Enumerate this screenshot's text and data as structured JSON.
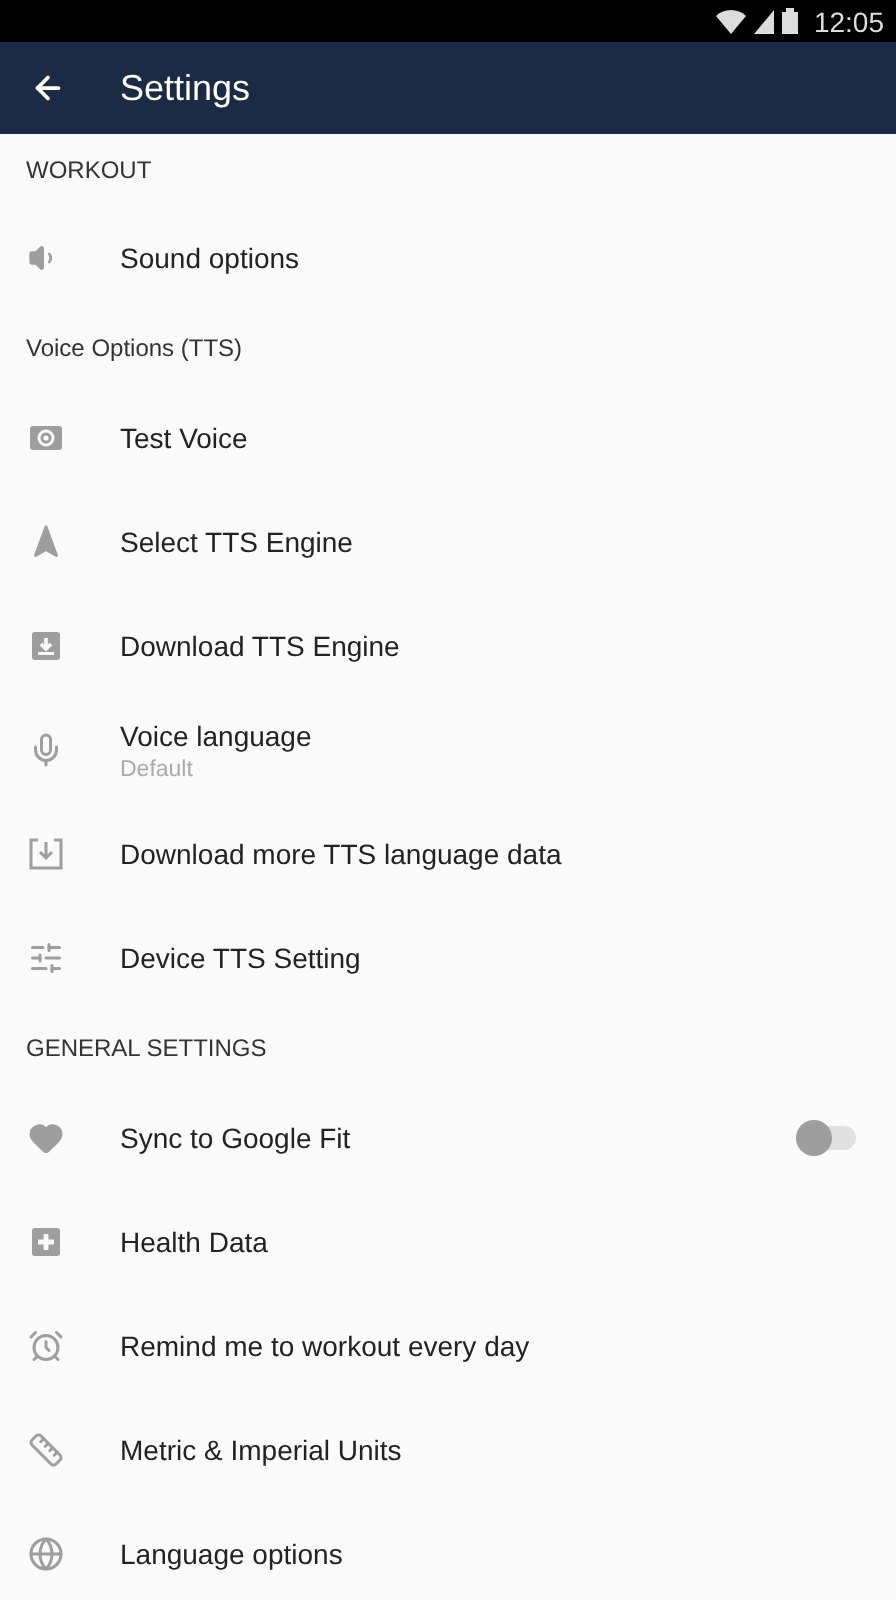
{
  "status_bar": {
    "time": "12:05"
  },
  "app_bar": {
    "title": "Settings"
  },
  "sections": [
    {
      "title": "WORKOUT",
      "items": [
        {
          "title": "Sound options"
        }
      ]
    },
    {
      "title": "Voice Options (TTS)",
      "items": [
        {
          "title": "Test Voice"
        },
        {
          "title": "Select TTS Engine"
        },
        {
          "title": "Download TTS Engine"
        },
        {
          "title": "Voice language",
          "subtitle": "Default"
        },
        {
          "title": "Download more TTS language data"
        },
        {
          "title": "Device TTS Setting"
        }
      ]
    },
    {
      "title": "GENERAL SETTINGS",
      "items": [
        {
          "title": "Sync to Google Fit",
          "kind": "switch",
          "on": false
        },
        {
          "title": "Health Data"
        },
        {
          "title": "Remind me to workout every day"
        },
        {
          "title": "Metric & Imperial Units"
        },
        {
          "title": "Language options"
        }
      ]
    }
  ]
}
